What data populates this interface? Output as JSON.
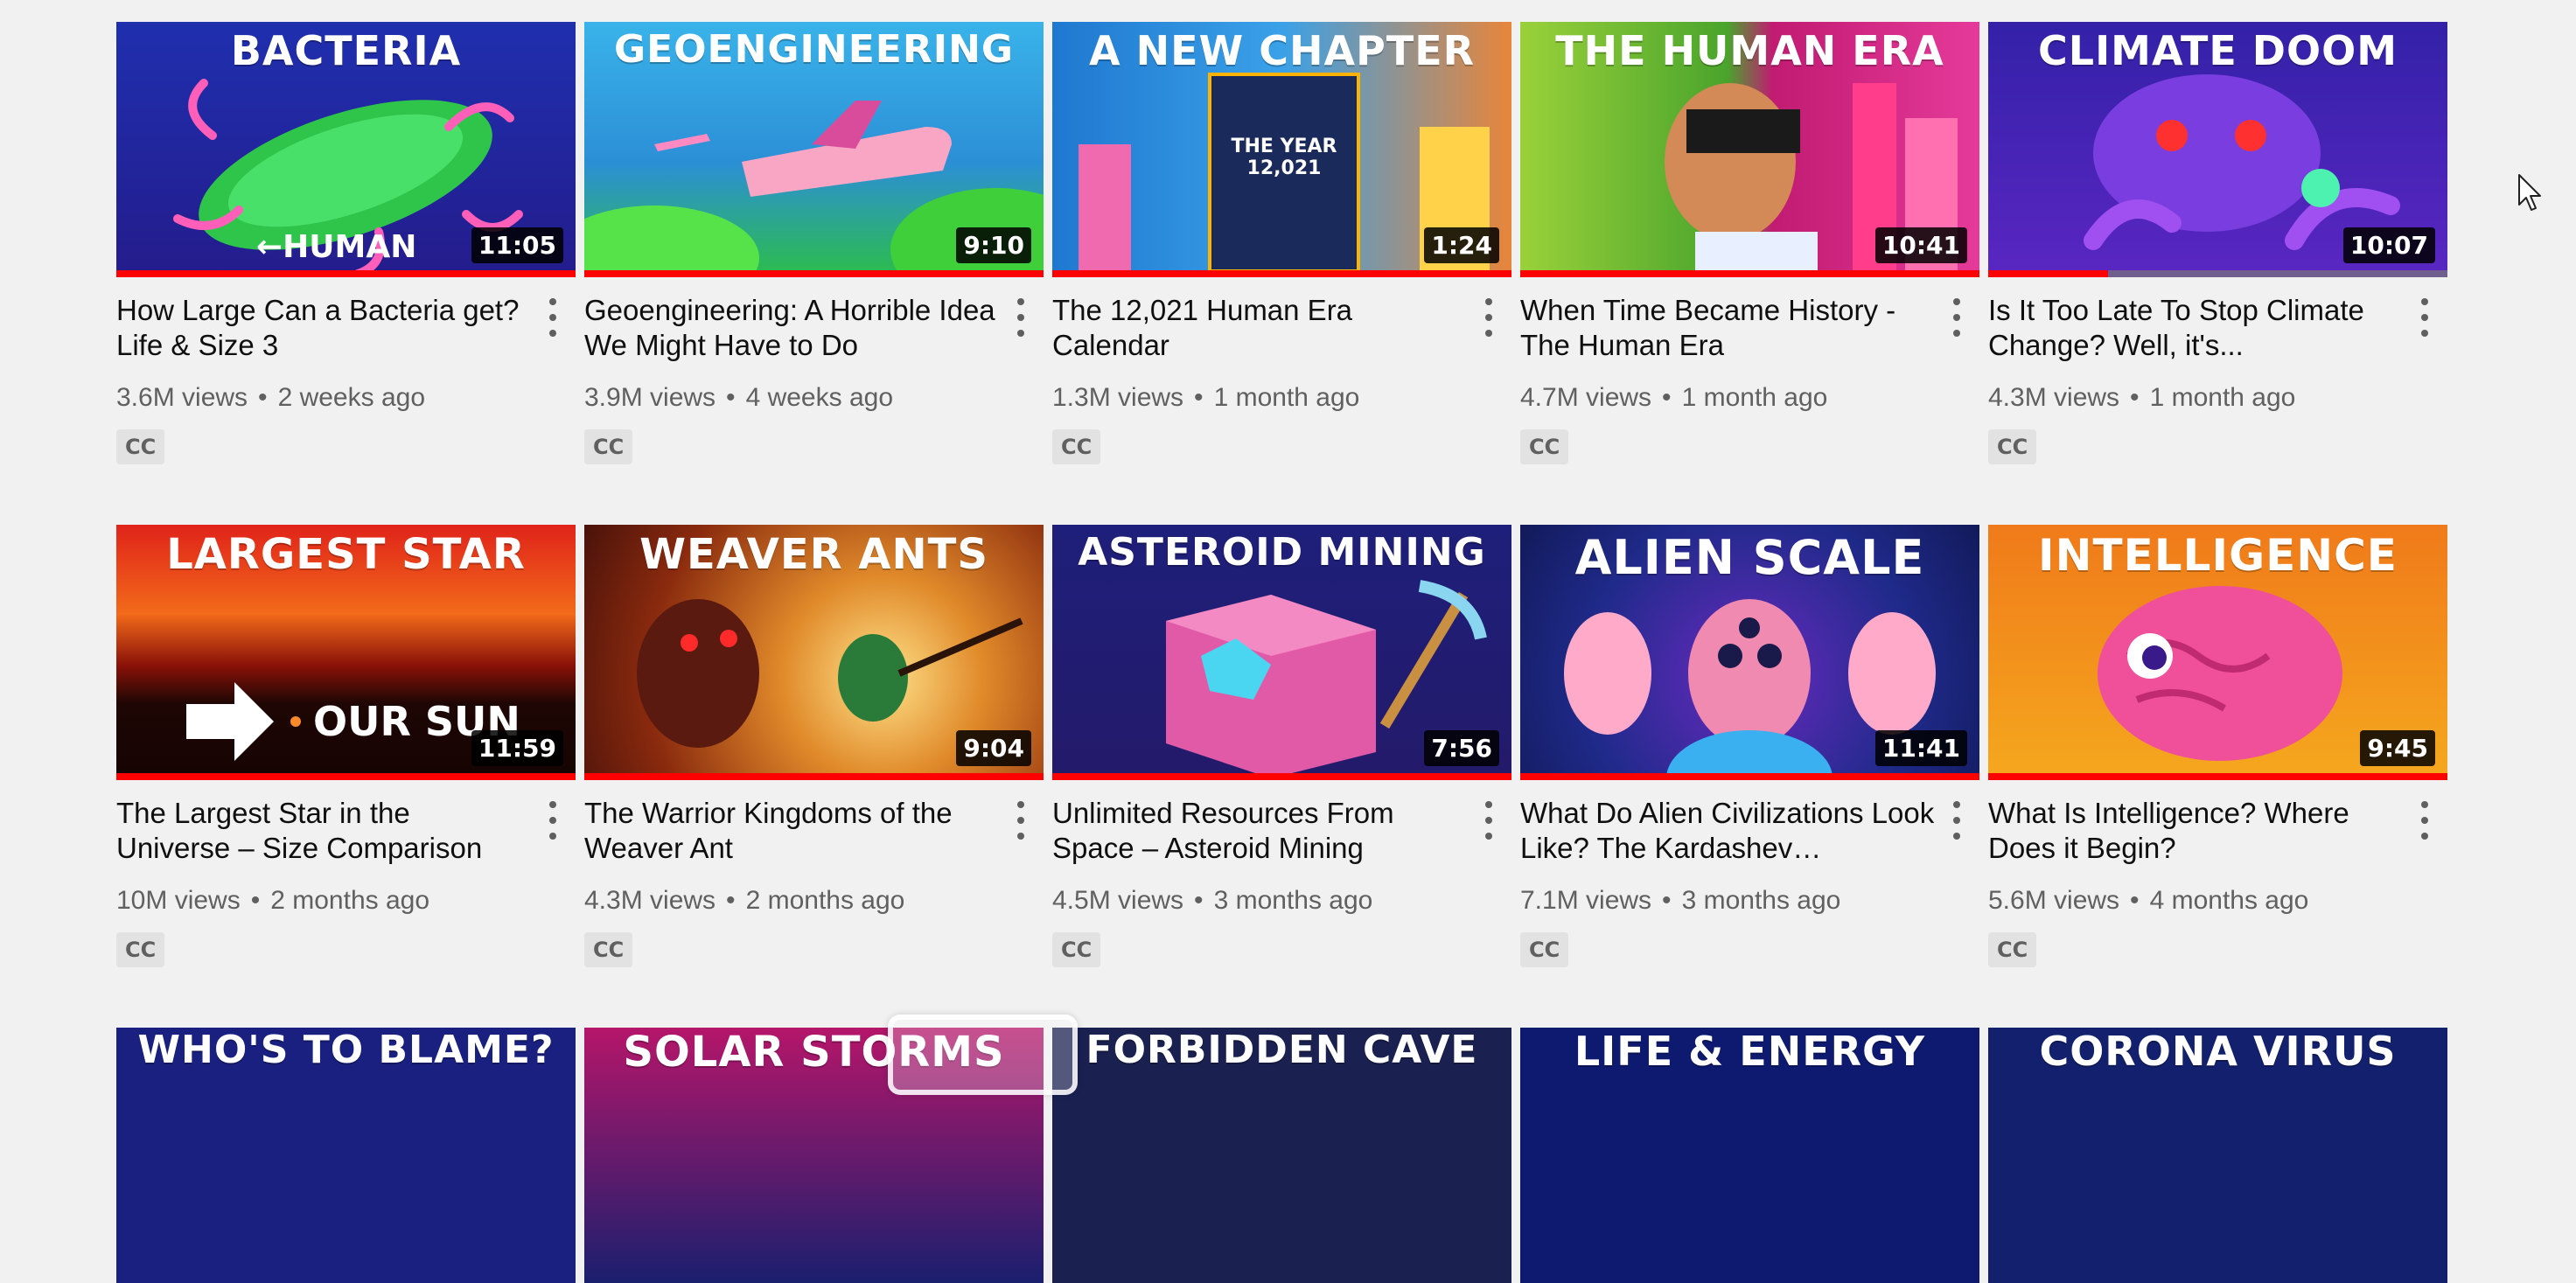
{
  "rows": [
    {
      "videos": [
        {
          "thumb_text": "BACTERIA",
          "sub_text": "←HUMAN",
          "duration": "11:05",
          "title": "How Large Can a Bacteria get? Life & Size 3",
          "views": "3.6M views",
          "age": "2 weeks ago",
          "cc": "CC",
          "progress": 1.0,
          "colors": [
            "#1a2a9a",
            "#2f1fb4"
          ]
        },
        {
          "thumb_text": "GEOENGINEERING",
          "sub_text": "",
          "duration": "9:10",
          "title": "Geoengineering: A Horrible Idea We Might Have to Do",
          "views": "3.9M views",
          "age": "4 weeks ago",
          "cc": "CC",
          "progress": 1.0,
          "colors": [
            "#2ea9e3",
            "#2bbd52"
          ]
        },
        {
          "thumb_text": "A NEW CHAPTER",
          "sub_text": "THE YEAR 12,021",
          "duration": "1:24",
          "title": "The 12,021 Human Era Calendar",
          "views": "1.3M views",
          "age": "1 month ago",
          "cc": "CC",
          "progress": 1.0,
          "colors": [
            "#1d86d8",
            "#e06a2c"
          ]
        },
        {
          "thumb_text": "THE HUMAN ERA",
          "sub_text": "",
          "duration": "10:41",
          "title": "When Time Became History - The Human Era",
          "views": "4.7M views",
          "age": "1 month ago",
          "cc": "CC",
          "progress": 1.0,
          "colors": [
            "#4fa52a",
            "#c4216a"
          ]
        },
        {
          "thumb_text": "CLIMATE DOOM",
          "sub_text": "",
          "duration": "10:07",
          "title": "Is It Too Late To Stop Climate Change? Well, it's...",
          "views": "4.3M views",
          "age": "1 month ago",
          "cc": "CC",
          "progress": 0.26,
          "colors": [
            "#3b1f9e",
            "#6a28c8"
          ]
        }
      ]
    },
    {
      "videos": [
        {
          "thumb_text": "LARGEST STAR",
          "sub_text": "OUR SUN",
          "duration": "11:59",
          "title": "The Largest Star in the Universe – Size Comparison",
          "views": "10M views",
          "age": "2 months ago",
          "cc": "CC",
          "progress": 1.0,
          "colors": [
            "#b81b0e",
            "#2a0906"
          ]
        },
        {
          "thumb_text": "WEAVER ANTS",
          "sub_text": "",
          "duration": "9:04",
          "title": "The Warrior Kingdoms of the Weaver Ant",
          "views": "4.3M views",
          "age": "2 months ago",
          "cc": "CC",
          "progress": 1.0,
          "colors": [
            "#c74a16",
            "#5a1a0c"
          ]
        },
        {
          "thumb_text": "ASTEROID MINING",
          "sub_text": "",
          "duration": "7:56",
          "title": "Unlimited Resources From Space – Asteroid Mining",
          "views": "4.5M views",
          "age": "3 months ago",
          "cc": "CC",
          "progress": 1.0,
          "colors": [
            "#1b1c6e",
            "#2a1f8c"
          ]
        },
        {
          "thumb_text": "ALIEN SCALE",
          "sub_text": "",
          "duration": "11:41",
          "title": "What Do Alien Civilizations Look Like? The Kardashev…",
          "views": "7.1M views",
          "age": "3 months ago",
          "cc": "CC",
          "progress": 1.0,
          "colors": [
            "#1d2a8a",
            "#5a1fa0"
          ]
        },
        {
          "thumb_text": "INTELLIGENCE",
          "sub_text": "",
          "duration": "9:45",
          "title": "What Is Intelligence? Where Does it Begin?",
          "views": "5.6M views",
          "age": "4 months ago",
          "cc": "CC",
          "progress": 1.0,
          "colors": [
            "#f08a1c",
            "#f5b21e"
          ]
        }
      ]
    },
    {
      "videos": [
        {
          "thumb_text": "WHO'S TO BLAME?",
          "colors": [
            "#1a2080",
            "#1a2080"
          ]
        },
        {
          "thumb_text": "SOLAR STORMS",
          "colors": [
            "#b5166a",
            "#1a1f6e"
          ]
        },
        {
          "thumb_text": "FORBIDDEN CAVE",
          "colors": [
            "#1a2050",
            "#1a2050"
          ]
        },
        {
          "thumb_text": "LIFE & ENERGY",
          "colors": [
            "#0e1a70",
            "#0e1a70"
          ]
        },
        {
          "thumb_text": "CORONA VIRUS",
          "colors": [
            "#12206e",
            "#12206e"
          ]
        }
      ]
    }
  ]
}
